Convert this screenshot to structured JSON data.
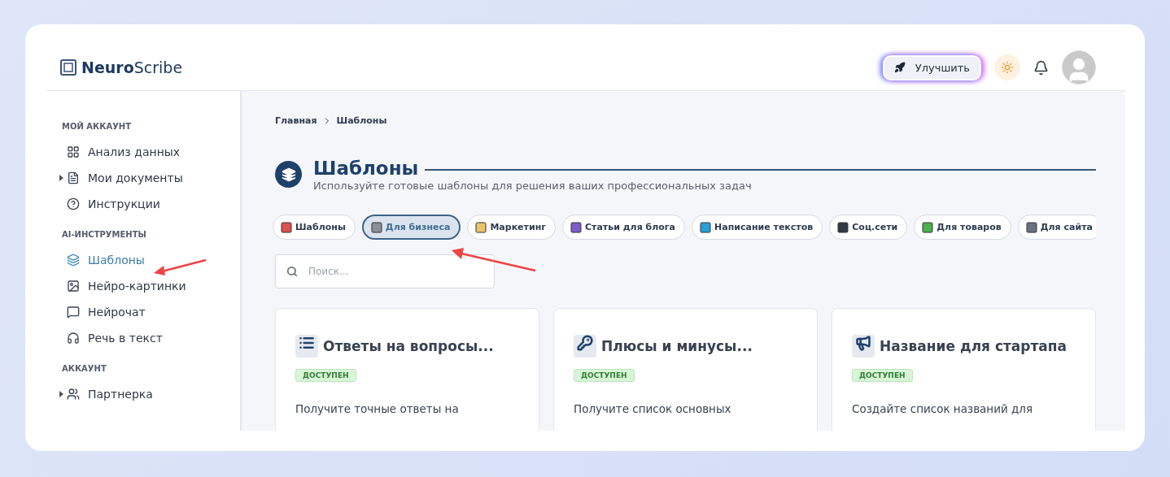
{
  "header": {
    "logo": "**Neuro**Scribe",
    "upgrade_button": "Улучшить"
  },
  "sidebar": {
    "sections": [
      {
        "title": "МОЙ АККАУНТ",
        "items": [
          {
            "label": "Анализ данных",
            "kind": "link",
            "selected": false
          },
          {
            "label": "Мои документы",
            "kind": "group",
            "selected": false
          },
          {
            "label": "Инструкции",
            "kind": "link",
            "selected": false
          }
        ]
      },
      {
        "title": "AI-ИНСТРУМЕНТЫ",
        "items": [
          {
            "label": "Шаблоны",
            "kind": "link",
            "selected": true
          },
          {
            "label": "Нейро-картинки",
            "kind": "link",
            "selected": false
          },
          {
            "label": "Нейрочат",
            "kind": "link",
            "selected": false
          },
          {
            "label": "Речь в текст",
            "kind": "link",
            "selected": false
          }
        ]
      },
      {
        "title": "АККАУНТ",
        "items": [
          {
            "label": "Партнерка",
            "kind": "group",
            "selected": false
          }
        ]
      }
    ]
  },
  "breadcrumb": [
    "Главная",
    "Шаблоны"
  ],
  "page": {
    "title": "Шаблоны",
    "subtitle": "Используйте готовые шаблоны для решения ваших профессиональных задач"
  },
  "categories": [
    {
      "label": "Шаблоны",
      "selected": false
    },
    {
      "label": "Для бизнеса",
      "selected": true
    },
    {
      "label": "Маркетинг",
      "selected": false
    },
    {
      "label": "Статьи для блога",
      "selected": false
    },
    {
      "label": "Написание текстов",
      "selected": false
    },
    {
      "label": "Соц.сети",
      "selected": false
    },
    {
      "label": "Для товаров",
      "selected": false
    },
    {
      "label": "Для сайта",
      "selected": false
    }
  ],
  "search": {
    "placeholder": "Поиск..."
  },
  "cards": [
    {
      "title": "Ответы на вопросы...",
      "badge": "ДОСТУПЕН",
      "description": "Получите точные ответы на"
    },
    {
      "title": "Плюсы и минусы...",
      "badge": "ДОСТУПЕН",
      "description": "Получите список основных"
    },
    {
      "title": "Название для стартапа",
      "badge": "ДОСТУПЕН",
      "description": "Создайте список названий для"
    }
  ]
}
